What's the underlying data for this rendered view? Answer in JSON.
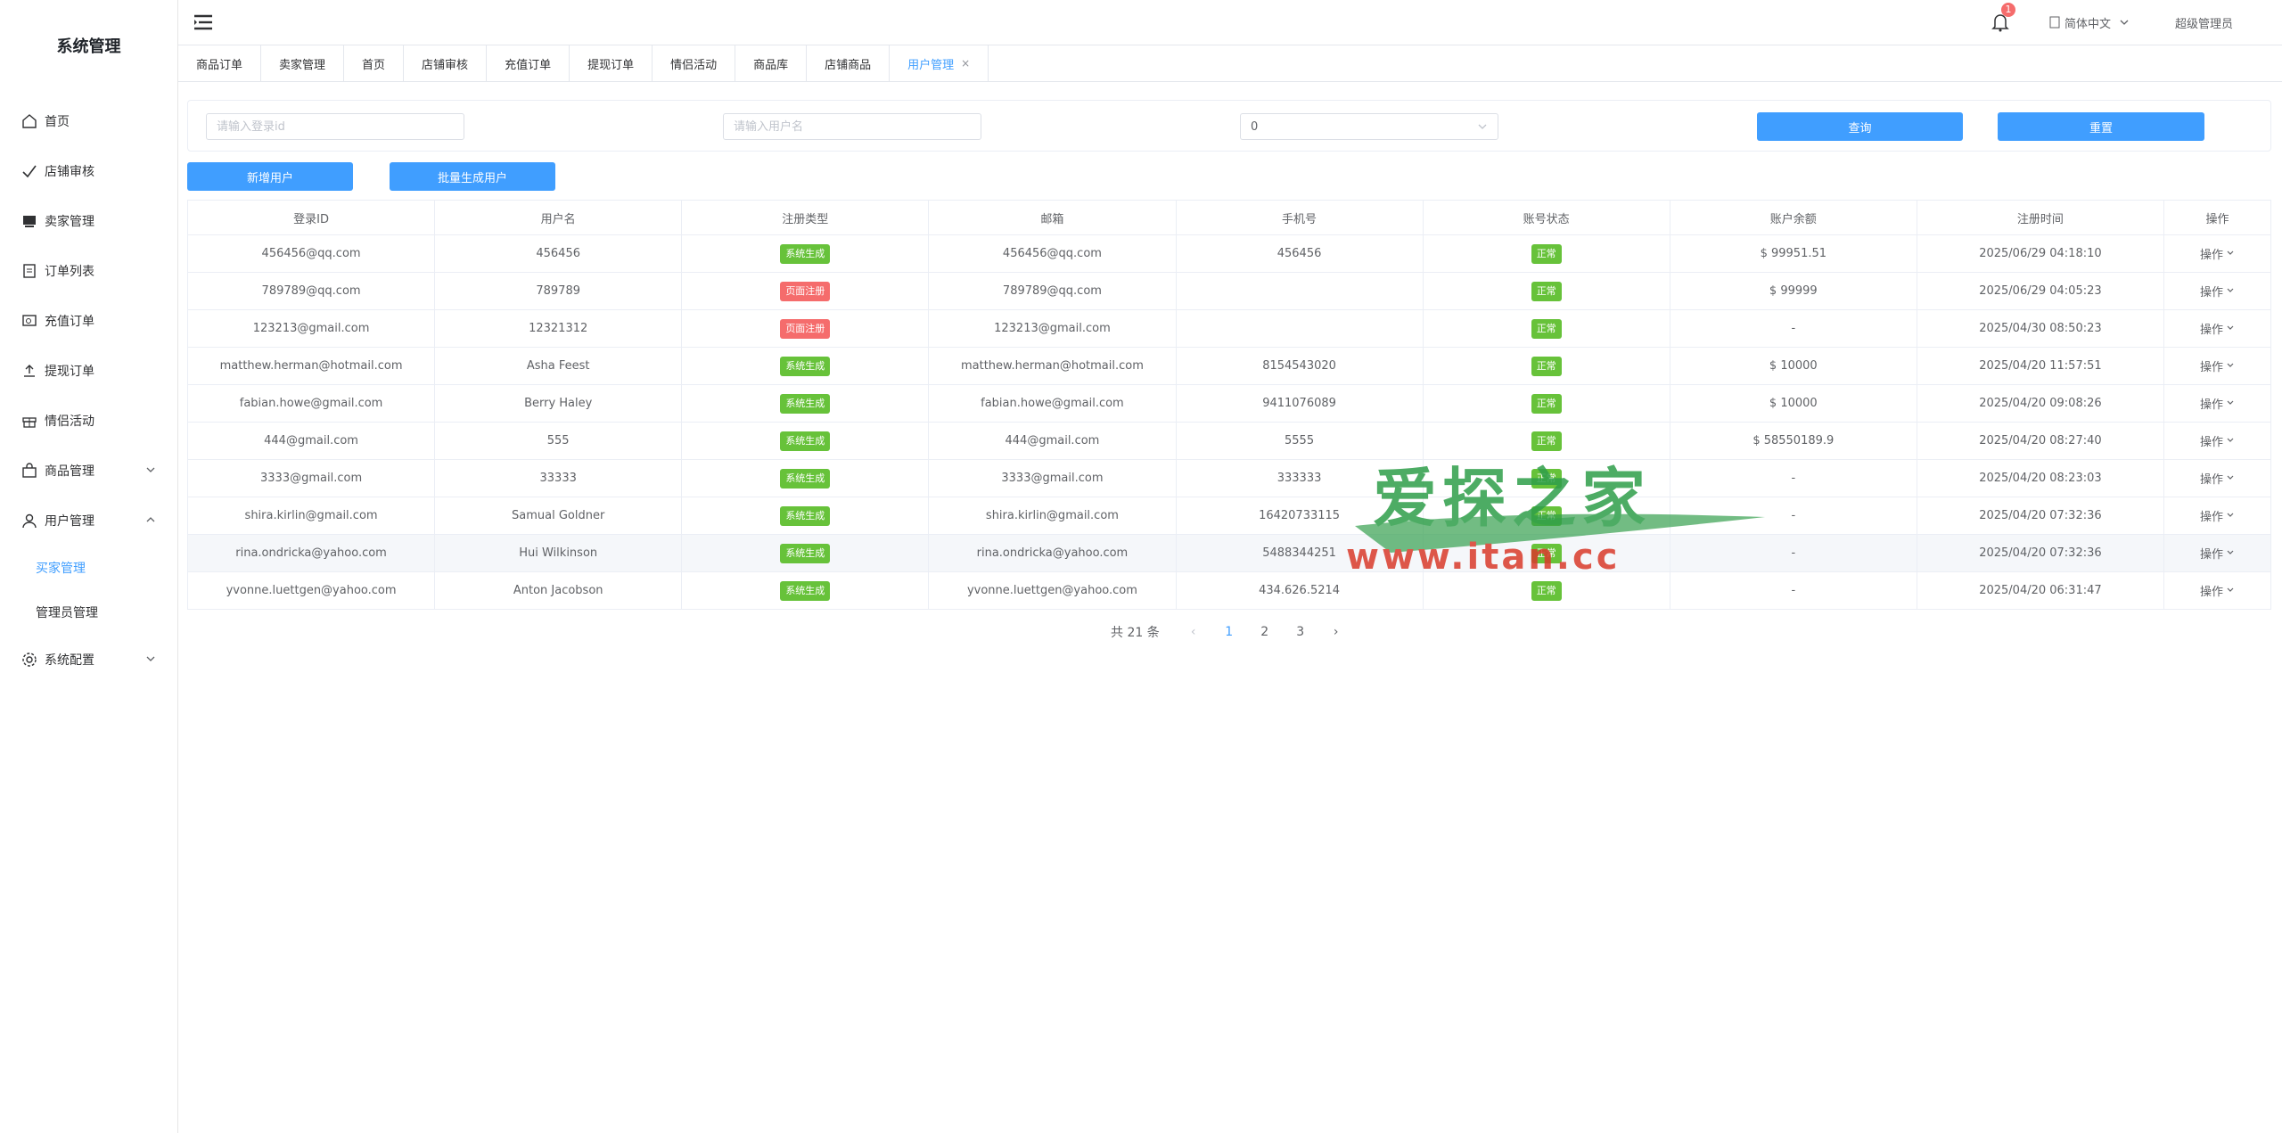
{
  "app": {
    "title": "系统管理"
  },
  "sidebar": {
    "items": [
      {
        "label": "首页",
        "icon": "home-icon"
      },
      {
        "label": "店铺审核",
        "icon": "check-icon"
      },
      {
        "label": "卖家管理",
        "icon": "seller-icon"
      },
      {
        "label": "订单列表",
        "icon": "document-icon"
      },
      {
        "label": "充值订单",
        "icon": "recharge-icon"
      },
      {
        "label": "提现订单",
        "icon": "upload-icon"
      },
      {
        "label": "情侣活动",
        "icon": "gift-icon"
      },
      {
        "label": "商品管理",
        "icon": "bag-icon"
      },
      {
        "label": "用户管理",
        "icon": "user-icon"
      },
      {
        "label": "系统配置",
        "icon": "gear-icon"
      }
    ],
    "user_sub": [
      {
        "label": "买家管理",
        "active": true
      },
      {
        "label": "管理员管理",
        "active": false
      }
    ]
  },
  "header": {
    "notification_count": "1",
    "language": "简体中文",
    "user": "超级管理员"
  },
  "tabs": [
    {
      "label": "商品订单"
    },
    {
      "label": "卖家管理"
    },
    {
      "label": "首页"
    },
    {
      "label": "店铺审核"
    },
    {
      "label": "充值订单"
    },
    {
      "label": "提现订单"
    },
    {
      "label": "情侣活动"
    },
    {
      "label": "商品库"
    },
    {
      "label": "店铺商品"
    },
    {
      "label": "用户管理",
      "active": true,
      "close": "×"
    }
  ],
  "filter": {
    "login_id_placeholder": "请输入登录id",
    "username_placeholder": "请输入用户名",
    "select_value": "0",
    "query_label": "查询",
    "reset_label": "重置"
  },
  "actions": {
    "add_user": "新增用户",
    "batch_generate": "批量生成用户"
  },
  "table": {
    "columns": [
      "登录ID",
      "用户名",
      "注册类型",
      "邮箱",
      "手机号",
      "账号状态",
      "账户余额",
      "注册时间",
      "操作"
    ],
    "rows": [
      [
        "456456@qq.com",
        "456456",
        "系统生成",
        "456456@qq.com",
        "456456",
        "正常",
        "$ 99951.51",
        "2025/06/29 04:18:10",
        "操作"
      ],
      [
        "789789@qq.com",
        "789789",
        "页面注册",
        "789789@qq.com",
        "",
        "正常",
        "$ 99999",
        "2025/06/29 04:05:23",
        "操作"
      ],
      [
        "123213@gmail.com",
        "12321312",
        "页面注册",
        "123213@gmail.com",
        "",
        "正常",
        "-",
        "2025/04/30 08:50:23",
        "操作"
      ],
      [
        "matthew.herman@hotmail.com",
        "Asha Feest",
        "系统生成",
        "matthew.herman@hotmail.com",
        "8154543020",
        "正常",
        "$ 10000",
        "2025/04/20 11:57:51",
        "操作"
      ],
      [
        "fabian.howe@gmail.com",
        "Berry Haley",
        "系统生成",
        "fabian.howe@gmail.com",
        "9411076089",
        "正常",
        "$ 10000",
        "2025/04/20 09:08:26",
        "操作"
      ],
      [
        "444@gmail.com",
        "555",
        "系统生成",
        "444@gmail.com",
        "5555",
        "正常",
        "$ 58550189.9",
        "2025/04/20 08:27:40",
        "操作"
      ],
      [
        "3333@gmail.com",
        "33333",
        "系统生成",
        "3333@gmail.com",
        "333333",
        "正常",
        "-",
        "2025/04/20 08:23:03",
        "操作"
      ],
      [
        "shira.kirlin@gmail.com",
        "Samual Goldner",
        "系统生成",
        "shira.kirlin@gmail.com",
        "16420733115",
        "正常",
        "-",
        "2025/04/20 07:32:36",
        "操作"
      ],
      [
        "rina.ondricka@yahoo.com",
        "Hui Wilkinson",
        "系统生成",
        "rina.ondricka@yahoo.com",
        "5488344251",
        "正常",
        "-",
        "2025/04/20 07:32:36",
        "操作"
      ],
      [
        "yvonne.luettgen@yahoo.com",
        "Anton Jacobson",
        "系统生成",
        "yvonne.luettgen@yahoo.com",
        "434.626.5214",
        "正常",
        "-",
        "2025/04/20 06:31:47",
        "操作"
      ]
    ]
  },
  "pagination": {
    "total": "共 21 条",
    "pages": [
      "1",
      "2",
      "3"
    ],
    "current": "1"
  },
  "watermark": {
    "text": "爱探之家",
    "url": "www.itan.cc"
  },
  "colors": {
    "primary": "#409eff",
    "success": "#67c23a",
    "danger": "#f56c6c"
  }
}
